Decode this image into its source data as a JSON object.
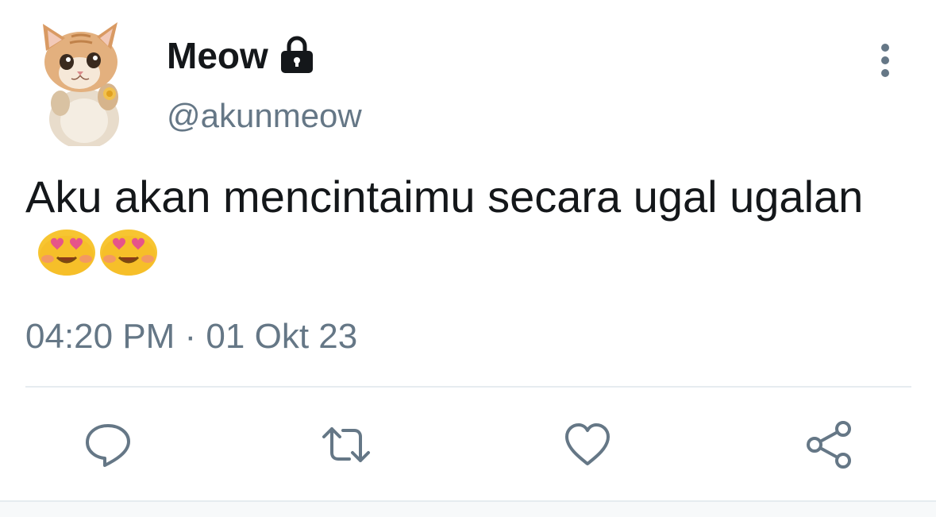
{
  "tweet": {
    "display_name": "Meow",
    "handle": "@akunmeow",
    "text": "Aku akan mencintaimu secara ugal ugalan",
    "emojis": [
      "smiling-face-with-heart-eyes",
      "smiling-face-with-heart-eyes"
    ],
    "timestamp": "04:20 PM · 01 Okt 23",
    "protected_icon": "lock-icon",
    "avatar": "cat-photo-avatar"
  },
  "actions": [
    {
      "name": "reply",
      "icon": "speech-bubble-icon"
    },
    {
      "name": "retweet",
      "icon": "retweet-arrows-icon"
    },
    {
      "name": "like",
      "icon": "heart-icon"
    },
    {
      "name": "share",
      "icon": "share-nodes-icon"
    }
  ],
  "colors": {
    "text_primary": "#14171a",
    "text_secondary": "#657786",
    "divider": "#e6ecf0",
    "icon": "#657786"
  }
}
